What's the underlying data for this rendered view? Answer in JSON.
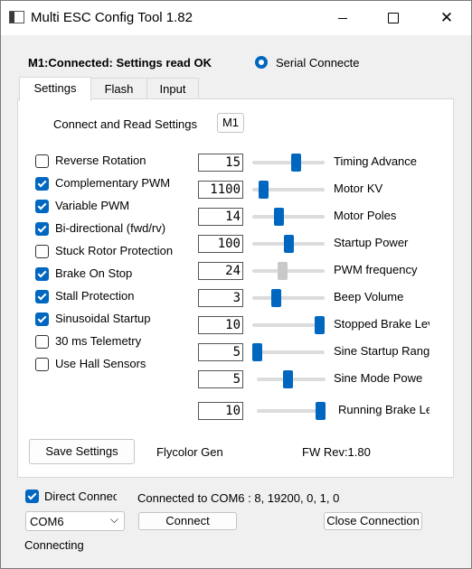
{
  "window": {
    "title": "Multi ESC Config Tool 1.82"
  },
  "status": {
    "connection_text": "M1:Connected: Settings read OK",
    "serial_label": "Serial Connecte",
    "serial_selected": true
  },
  "tabs": [
    {
      "label": "Settings",
      "active": true
    },
    {
      "label": "Flash",
      "active": false
    },
    {
      "label": "Input",
      "active": false
    }
  ],
  "settings": {
    "connect_read_label": "Connect and Read Settings",
    "motor_button": "M1",
    "checkboxes": [
      {
        "label": "Reverse Rotation",
        "checked": false
      },
      {
        "label": "Complementary PWM",
        "checked": true
      },
      {
        "label": "Variable PWM",
        "checked": true
      },
      {
        "label": "Bi-directional (fwd/rv)",
        "checked": true
      },
      {
        "label": "Stuck Rotor Protection",
        "checked": false
      },
      {
        "label": "Brake On Stop",
        "checked": true
      },
      {
        "label": "Stall Protection",
        "checked": true
      },
      {
        "label": "Sinusoidal Startup",
        "checked": true
      },
      {
        "label": "30 ms Telemetry",
        "checked": false
      },
      {
        "label": "Use Hall Sensors",
        "checked": false
      }
    ],
    "sliders": [
      {
        "label": "Timing Advance",
        "value": "15",
        "level": 0.62
      },
      {
        "label": "Motor KV",
        "value": "1100",
        "level": 0.1
      },
      {
        "label": "Motor Poles",
        "value": "14",
        "level": 0.35
      },
      {
        "label": "Startup Power",
        "value": "100",
        "level": 0.5
      },
      {
        "label": "PWM frequency",
        "value": "24",
        "level": 0.4,
        "disabled": true
      },
      {
        "label": "Beep Volume",
        "value": "3",
        "level": 0.3
      },
      {
        "label": "Stopped Brake Lev",
        "value": "10",
        "level": 1.0
      },
      {
        "label": "Sine Startup Rang",
        "value": "5",
        "level": 0.0
      },
      {
        "label": "Sine Mode Powe",
        "value": "5",
        "level": 0.45
      },
      {
        "label": "Running Brake Le",
        "value": "10",
        "level": 1.0
      }
    ],
    "save_button": "Save Settings",
    "firmware_name": "Flycolor Gen",
    "firmware_rev": "FW Rev:1.80"
  },
  "footer": {
    "direct_connect_label": "Direct Connec",
    "direct_connect_checked": true,
    "connected_info": "Connected to COM6 : 8, 19200, 0, 1, 0",
    "port_value": "COM6",
    "connect_button": "Connect",
    "close_button": "Close Connection",
    "status_text": "Connecting"
  },
  "colors": {
    "accent": "#0067c0",
    "background": "#f0f0f0",
    "panel": "#ffffff"
  }
}
